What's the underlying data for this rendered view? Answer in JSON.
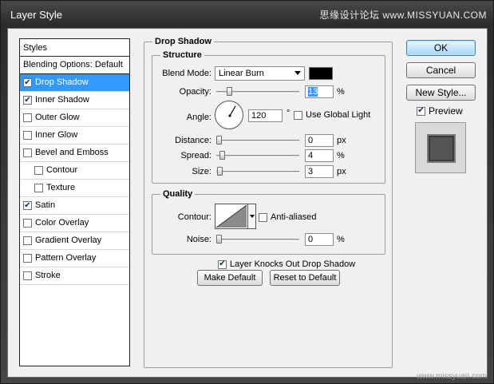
{
  "window": {
    "title": "Layer Style",
    "watermark": "思缘设计论坛 www.MISSYUAN.COM",
    "watermark_bottom": "www.missyuan.com"
  },
  "styles_panel": {
    "header": "Styles",
    "items": [
      {
        "label": "Blending Options: Default",
        "checkbox": false,
        "checked": false,
        "selected": false,
        "indent": false
      },
      {
        "label": "Drop Shadow",
        "checkbox": true,
        "checked": true,
        "selected": true,
        "indent": false
      },
      {
        "label": "Inner Shadow",
        "checkbox": true,
        "checked": true,
        "selected": false,
        "indent": false
      },
      {
        "label": "Outer Glow",
        "checkbox": true,
        "checked": false,
        "selected": false,
        "indent": false
      },
      {
        "label": "Inner Glow",
        "checkbox": true,
        "checked": false,
        "selected": false,
        "indent": false
      },
      {
        "label": "Bevel and Emboss",
        "checkbox": true,
        "checked": false,
        "selected": false,
        "indent": false
      },
      {
        "label": "Contour",
        "checkbox": true,
        "checked": false,
        "selected": false,
        "indent": true
      },
      {
        "label": "Texture",
        "checkbox": true,
        "checked": false,
        "selected": false,
        "indent": true
      },
      {
        "label": "Satin",
        "checkbox": true,
        "checked": true,
        "selected": false,
        "indent": false
      },
      {
        "label": "Color Overlay",
        "checkbox": true,
        "checked": false,
        "selected": false,
        "indent": false
      },
      {
        "label": "Gradient Overlay",
        "checkbox": true,
        "checked": false,
        "selected": false,
        "indent": false
      },
      {
        "label": "Pattern Overlay",
        "checkbox": true,
        "checked": false,
        "selected": false,
        "indent": false
      },
      {
        "label": "Stroke",
        "checkbox": true,
        "checked": false,
        "selected": false,
        "indent": false
      }
    ]
  },
  "drop_shadow": {
    "title": "Drop Shadow",
    "structure": {
      "title": "Structure",
      "blend_mode_label": "Blend Mode:",
      "blend_mode_value": "Linear Burn",
      "color": "#000000",
      "opacity_label": "Opacity:",
      "opacity_value": "13",
      "opacity_fraction": 0.13,
      "percent": "%",
      "angle_label": "Angle:",
      "angle_value": "120",
      "angle_degrees": 120,
      "degree_symbol": "°",
      "use_global_light_label": "Use Global Light",
      "use_global_light_checked": false,
      "distance_label": "Distance:",
      "distance_value": "0",
      "distance_fraction": 0.0,
      "spread_label": "Spread:",
      "spread_value": "4",
      "spread_fraction": 0.04,
      "size_label": "Size:",
      "size_value": "3",
      "size_fraction": 0.01,
      "px": "px"
    },
    "quality": {
      "title": "Quality",
      "contour_label": "Contour:",
      "anti_aliased_label": "Anti-aliased",
      "anti_aliased_checked": false,
      "noise_label": "Noise:",
      "noise_value": "0",
      "noise_fraction": 0.0
    },
    "knockout_label": "Layer Knocks Out Drop Shadow",
    "knockout_checked": true,
    "make_default_label": "Make Default",
    "reset_default_label": "Reset to Default"
  },
  "buttons": {
    "ok": "OK",
    "cancel": "Cancel",
    "new_style": "New Style...",
    "preview_label": "Preview",
    "preview_checked": true
  }
}
